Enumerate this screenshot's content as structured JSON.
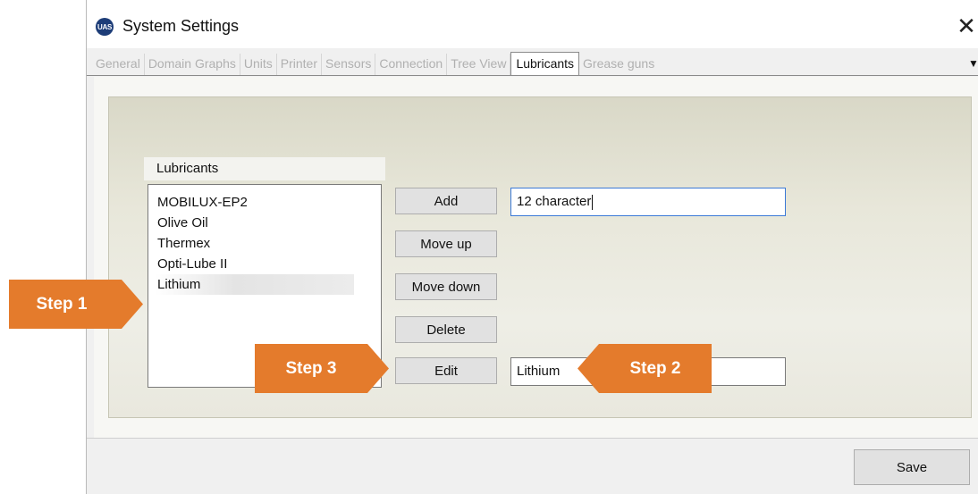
{
  "window": {
    "title": "System Settings",
    "icon_text": "UAS",
    "close_glyph": "✕"
  },
  "tabs": [
    {
      "label": "General",
      "active": false
    },
    {
      "label": "Domain Graphs",
      "active": false
    },
    {
      "label": "Units",
      "active": false
    },
    {
      "label": "Printer",
      "active": false
    },
    {
      "label": "Sensors",
      "active": false
    },
    {
      "label": "Connection",
      "active": false
    },
    {
      "label": "Tree View",
      "active": false
    },
    {
      "label": "Lubricants",
      "active": true
    },
    {
      "label": "Grease guns",
      "active": false
    }
  ],
  "tab_scroll_glyph": "▼",
  "lubricants": {
    "group_label": "Lubricants",
    "items": [
      "MOBILUX-EP2",
      "Olive Oil",
      "Thermex",
      "Opti-Lube II",
      "Lithium"
    ],
    "selected_index": 4
  },
  "buttons": {
    "add": "Add",
    "move_up": "Move up",
    "move_down": "Move down",
    "delete": "Delete",
    "edit": "Edit",
    "save": "Save"
  },
  "inputs": {
    "add_value": "12 character",
    "edit_value": "Lithium"
  },
  "callouts": {
    "step1": "Step 1",
    "step2": "Step 2",
    "step3": "Step 3",
    "color": "#e47b2c"
  }
}
